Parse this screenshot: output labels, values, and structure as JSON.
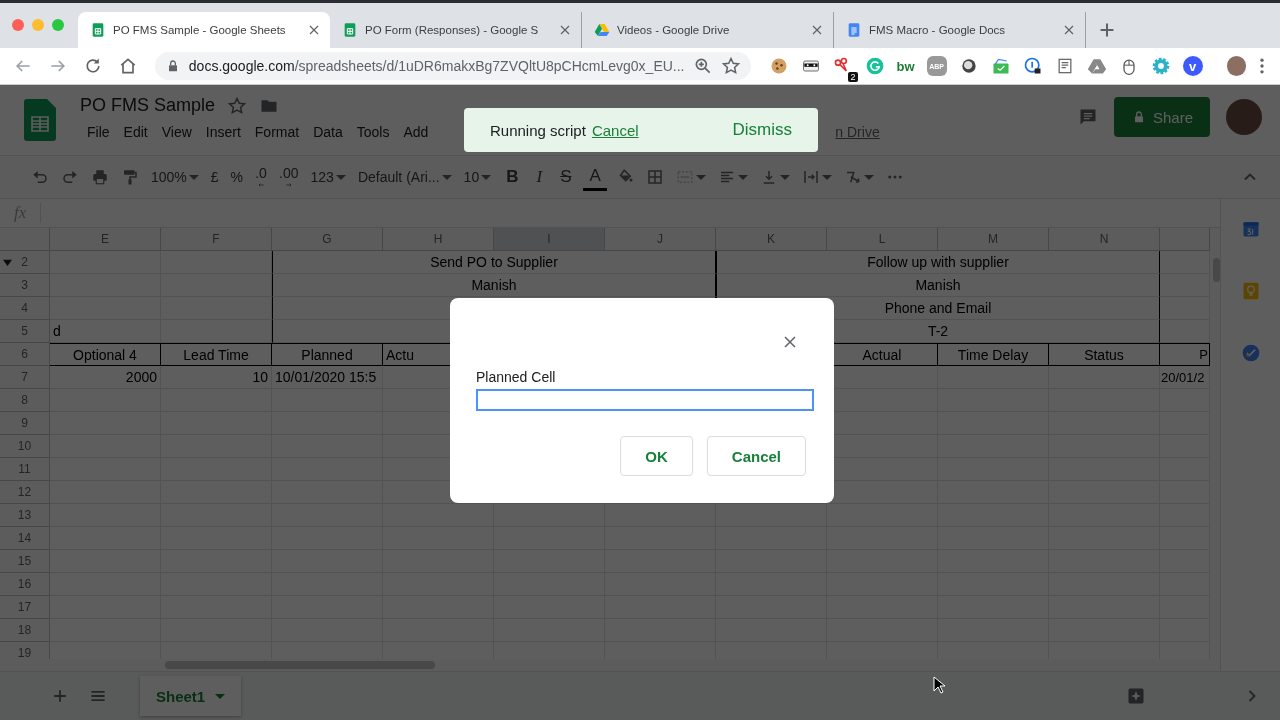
{
  "browser": {
    "tabs": [
      {
        "title": "PO FMS Sample - Google Sheets",
        "kind": "sheets",
        "selected": true
      },
      {
        "title": "PO Form (Responses) - Google S",
        "kind": "sheets",
        "selected": false
      },
      {
        "title": "Videos - Google Drive",
        "kind": "drive",
        "selected": false
      },
      {
        "title": "FMS Macro - Google Docs",
        "kind": "docs",
        "selected": false
      }
    ],
    "address": {
      "host": "docs.google.com",
      "path": "/spreadsheets/d/1uDR6makxBg7ZVQltU8pCHcmLevg0x_EU..."
    },
    "extensions": [
      {
        "kind": "cookie"
      },
      {
        "kind": "mask"
      },
      {
        "kind": "scissors",
        "badge": "2"
      },
      {
        "kind": "gcircle"
      },
      {
        "kind": "label",
        "text": "bw"
      },
      {
        "kind": "octagon",
        "text": "ABP"
      },
      {
        "kind": "ring"
      },
      {
        "kind": "envelope"
      },
      {
        "kind": "lockcircle"
      },
      {
        "kind": "note"
      },
      {
        "kind": "drive"
      },
      {
        "kind": "mouse"
      },
      {
        "kind": "gear"
      },
      {
        "kind": "letter",
        "text": "v"
      }
    ]
  },
  "document": {
    "title": "PO FMS Sample",
    "menu": [
      "File",
      "Edit",
      "View",
      "Insert",
      "Format",
      "Data",
      "Tools",
      "Add"
    ],
    "last_edit": "n Drive",
    "share": "Share"
  },
  "toolbar": [
    {
      "kind": "undo"
    },
    {
      "kind": "redo"
    },
    {
      "kind": "print"
    },
    {
      "kind": "paint"
    },
    {
      "kind": "dropdown",
      "text": "100%"
    },
    {
      "kind": "text",
      "text": "£"
    },
    {
      "kind": "text",
      "text": "%"
    },
    {
      "kind": "decimal",
      "text": ".0"
    },
    {
      "kind": "decimal",
      "text": ".00"
    },
    {
      "kind": "dropdown",
      "text": "123"
    },
    {
      "kind": "dropdown",
      "text": "Default (Ari..."
    },
    {
      "kind": "dropdown",
      "text": "10"
    },
    {
      "kind": "bold",
      "text": "B"
    },
    {
      "kind": "italic",
      "text": "I"
    },
    {
      "kind": "strike",
      "text": "S"
    },
    {
      "kind": "color",
      "text": "A"
    },
    {
      "kind": "fill"
    },
    {
      "kind": "borders"
    },
    {
      "kind": "merge"
    },
    {
      "kind": "align"
    },
    {
      "kind": "valign"
    },
    {
      "kind": "wrap"
    },
    {
      "kind": "rotate"
    },
    {
      "kind": "more"
    }
  ],
  "formula_bar": {
    "label": "fx"
  },
  "sheet": {
    "columns": [
      {
        "label": "E",
        "selected": false
      },
      {
        "label": "F",
        "selected": false
      },
      {
        "label": "G",
        "selected": false
      },
      {
        "label": "H",
        "selected": false
      },
      {
        "label": "I",
        "selected": true
      },
      {
        "label": "J",
        "selected": false
      },
      {
        "label": "K",
        "selected": false
      },
      {
        "label": "L",
        "selected": false
      },
      {
        "label": "M",
        "selected": false
      },
      {
        "label": "N",
        "selected": false
      }
    ],
    "rows": [
      {
        "number": "2",
        "kind": "group",
        "cells": [
          "",
          "",
          "Send PO to Supplier",
          "Follow up with supplier",
          ""
        ]
      },
      {
        "number": "3",
        "kind": "group",
        "cells": [
          "",
          "",
          "Manish",
          "Manish",
          ""
        ]
      },
      {
        "number": "4",
        "kind": "group",
        "cells": [
          "",
          "",
          "",
          "Phone and Email",
          ""
        ]
      },
      {
        "number": "5",
        "kind": "group",
        "cells": [
          "d",
          "",
          "",
          "T-2",
          ""
        ]
      },
      {
        "number": "6",
        "kind": "header",
        "cells": [
          "Optional 4",
          "Lead Time",
          "Planned",
          "Actu",
          "",
          "",
          "",
          "Actual",
          "Time Delay",
          "Status",
          "P"
        ]
      },
      {
        "number": "7",
        "kind": "plain",
        "cells": [
          "2000",
          "10",
          "10/01/2020 15:5",
          "",
          "",
          "",
          "",
          "",
          "",
          "",
          "20/01/2"
        ]
      },
      {
        "number": "8",
        "kind": "plain"
      },
      {
        "number": "9",
        "kind": "plain"
      },
      {
        "number": "10",
        "kind": "plain"
      },
      {
        "number": "11",
        "kind": "plain"
      },
      {
        "number": "12",
        "kind": "plain"
      },
      {
        "number": "13",
        "kind": "plain"
      },
      {
        "number": "14",
        "kind": "plain"
      },
      {
        "number": "15",
        "kind": "plain"
      },
      {
        "number": "16",
        "kind": "plain"
      },
      {
        "number": "17",
        "kind": "plain"
      },
      {
        "number": "18",
        "kind": "plain"
      },
      {
        "number": "19",
        "kind": "plain"
      }
    ]
  },
  "sheet_tabs": [
    {
      "label": "Sheet1",
      "selected": true
    }
  ],
  "toast": {
    "message": "Running script",
    "link": "Cancel",
    "action": "Dismiss"
  },
  "dialog": {
    "label": "Planned Cell",
    "field": {
      "focused": true
    },
    "buttons": [
      "OK",
      "Cancel"
    ]
  }
}
